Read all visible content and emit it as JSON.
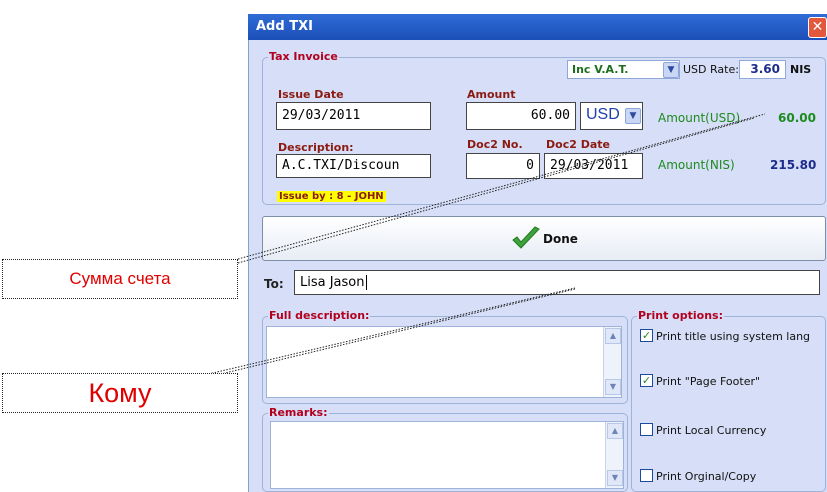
{
  "window": {
    "title": "Add TXI",
    "close_symbol": "✕"
  },
  "tax_invoice": {
    "legend": "Tax Invoice",
    "vat_select": "Inc V.A.T.",
    "usd_rate_label": "USD Rate:",
    "usd_rate_value": "3.60",
    "usd_rate_unit": "NIS",
    "issue_date_label": "Issue Date",
    "issue_date_value": "29/03/2011",
    "amount_label": "Amount",
    "amount_value": "60.00",
    "currency": "USD",
    "amount_usd_label": "Amount(USD)",
    "amount_usd_value": "60.00",
    "description_label": "Description:",
    "description_value": "A.C.TXI/Discoun",
    "doc2_no_label": "Doc2 No.",
    "doc2_no_value": "0",
    "doc2_date_label": "Doc2 Date",
    "doc2_date_value": "29/03/2011",
    "amount_nis_label": "Amount(NIS)",
    "amount_nis_value": "215.80",
    "issue_by": "Issue by : 8 - JOHN"
  },
  "done_button": {
    "label": "Done",
    "icon": "checkmark-icon"
  },
  "to": {
    "label": "To:",
    "value": "Lisa Jason"
  },
  "full_description": {
    "legend": "Full description:"
  },
  "remarks": {
    "legend": "Remarks:"
  },
  "print_options": {
    "legend": "Print options:",
    "items": [
      {
        "label": "Print title using system lang",
        "checked": true
      },
      {
        "label": "Print \"Page Footer\"",
        "checked": true
      },
      {
        "label": "Print Local Currency",
        "checked": false
      },
      {
        "label": "Print Orginal/Copy",
        "checked": false
      }
    ]
  },
  "callouts": {
    "amount": "Сумма счета",
    "to": "Кому"
  },
  "colors": {
    "title_bar": "#2f6bd6",
    "window_bg": "#d6dff7",
    "legend_red": "#b2001e",
    "green": "#1e8a1e",
    "navy": "#1d2c8c",
    "callout_red": "#e00000",
    "highlight": "#ffff00"
  }
}
